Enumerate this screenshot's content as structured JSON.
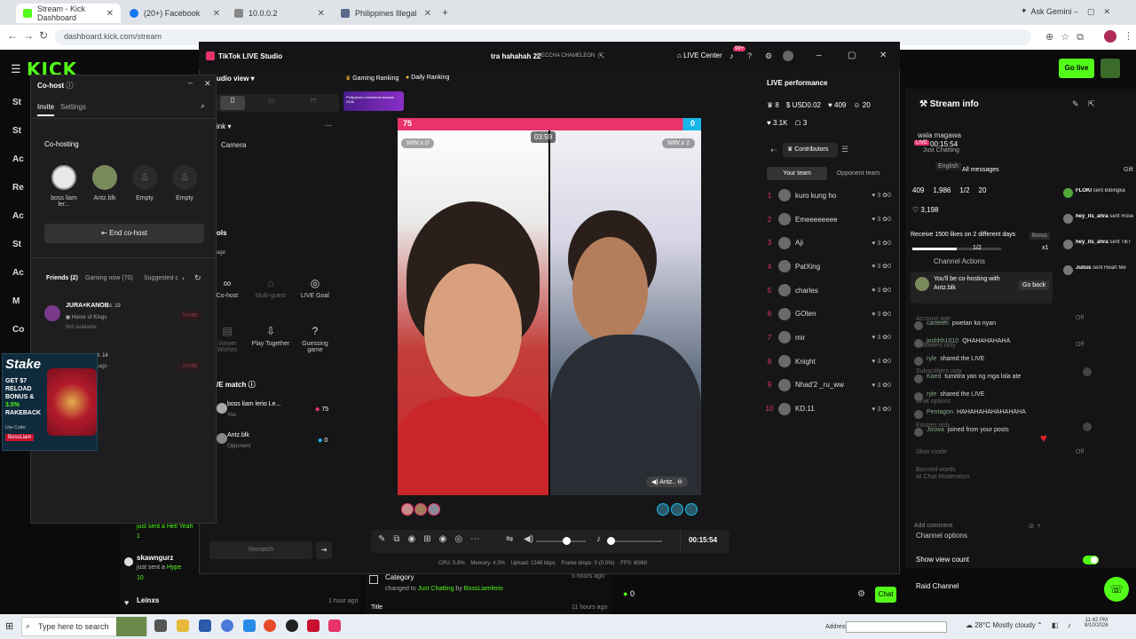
{
  "browser": {
    "tabs": [
      {
        "label": "Stream - Kick Dashboard",
        "active": true,
        "color": "#53fc18"
      },
      {
        "label": "(20+) Facebook",
        "active": false,
        "color": "#1877f2"
      },
      {
        "label": "10.0.0.2",
        "active": false,
        "color": "#888888"
      },
      {
        "label": "Philippines Illegal Site Promotio",
        "active": false,
        "color": "#5a6b8c"
      }
    ],
    "new_tab": "+",
    "url": "dashboard.kick.com/stream",
    "ask_gemini": "Ask Gemini"
  },
  "kick": {
    "logo": "KICK",
    "nav": [
      "St",
      "St",
      "Ac",
      "Re",
      "Ac",
      "St",
      "Ac",
      "M",
      "Co"
    ],
    "go_live": "Go live",
    "events": [
      {
        "user": "skawngurz",
        "action": "just sent a",
        "item": "Hype",
        "amount": "10"
      },
      {
        "user": "Leinxs",
        "time": "1 hour ago"
      }
    ],
    "partial_event": {
      "action": "just sent a",
      "item": "Hell Yeah",
      "amount": "1"
    },
    "category": {
      "title": "Category",
      "changed": "changed to",
      "to": "Just Chatting",
      "by": "by",
      "user": "BossLiamlerio",
      "time": "5 hours ago"
    },
    "title_row": {
      "title": "Title",
      "time": "11 hours ago"
    },
    "chat_count": "0",
    "chat_btn": "Chat"
  },
  "cohost": {
    "title": "Co-host",
    "tabs": [
      "Invite",
      "Settings"
    ],
    "section": "Co-hosting",
    "slots": [
      {
        "name": "boss liam ler..."
      },
      {
        "name": "Antz.blk"
      },
      {
        "name": "Empty"
      },
      {
        "name": "Empty"
      }
    ],
    "end_btn": "End co-host",
    "filters": [
      "Friends (2)",
      "Gaming now (70)",
      "Suggested c"
    ],
    "friends": [
      {
        "name": "JURA×KANOB",
        "level": "19",
        "game": "Honor of Kings",
        "status": "Not available",
        "btn": "Invite"
      },
      {
        "name": "",
        "level": "14",
        "game": "...ags",
        "status": "",
        "btn": "Invite"
      }
    ]
  },
  "ad": {
    "brand": "Stake",
    "lines": [
      "GET $7",
      "RELOAD",
      "BONUS &",
      "3.5%",
      "RAKEBACK"
    ],
    "code_label": "Use Code:",
    "code": "BossLiam"
  },
  "tiktok": {
    "app_title": "TikTok LIVE Studio",
    "stream_title": "tra hahahah 22",
    "stream_sub": "MECCHA CHAMELEON",
    "live_center": "LIVE Center",
    "badge": "99+",
    "audio_view": "udio view",
    "source_head": "ink",
    "source": "Camera",
    "tools_head": "ols",
    "tools_sub": "age",
    "tools": [
      {
        "icon": "∞",
        "label": "Co-host"
      },
      {
        "icon": "⌂",
        "label": "Multi-guest"
      },
      {
        "icon": "◎",
        "label": "LIVE Goal"
      },
      {
        "icon": "▤",
        "label": "Viewer Wishes"
      },
      {
        "icon": "⇩",
        "label": "Play Together"
      },
      {
        "icon": "?",
        "label": "Guessing game"
      }
    ],
    "match_head": "/E match",
    "match": [
      {
        "name": "boss liam lerio Le...",
        "sub": "You",
        "score": "75"
      },
      {
        "name": "Antz.blk",
        "sub": "Opponent",
        "score": "0"
      }
    ],
    "rematch": "Rematch",
    "rankings": [
      "Gaming Ranking",
      "Daily Ranking"
    ],
    "promo": "Philippines Livestream Awards 2026",
    "score_left": "75",
    "score_right": "0",
    "win_left": "WIN x 0",
    "win_right": "WIN x 1",
    "timer": "03:59",
    "opponent": "Antz..",
    "elapsed": "00:15:54",
    "stats": "CPU: 5.8%    Memory: 4.3%    Upload: 1348 kbps    Frame drops: 0 (0.0%)    FPS: 60/60"
  },
  "performance": {
    "title": "LIVE performance",
    "stats": [
      {
        "icon": "♛",
        "val": "8"
      },
      {
        "icon": "$",
        "val": "USD0.02"
      },
      {
        "icon": "♥",
        "val": "409"
      },
      {
        "icon": "☺",
        "val": "20"
      },
      {
        "icon": "♥",
        "val": "3.1K"
      },
      {
        "icon": "☖",
        "val": "3"
      }
    ],
    "contributors": "Contributors",
    "tabs": [
      "Your team",
      "Opponent team"
    ],
    "ranks": [
      {
        "n": "1",
        "name": "kuro kung ho",
        "a": "3",
        "b": "0"
      },
      {
        "n": "2",
        "name": "Emeeeeeeee",
        "a": "3",
        "b": "0"
      },
      {
        "n": "3",
        "name": "Aji",
        "a": "3",
        "b": "0"
      },
      {
        "n": "4",
        "name": "PatXing",
        "a": "3",
        "b": "0"
      },
      {
        "n": "5",
        "name": "charles",
        "a": "3",
        "b": "0"
      },
      {
        "n": "6",
        "name": "GOten",
        "a": "3",
        "b": "0"
      },
      {
        "n": "7",
        "name": "mir",
        "a": "3",
        "b": "0"
      },
      {
        "n": "8",
        "name": "Knight",
        "a": "3",
        "b": "0"
      },
      {
        "n": "9",
        "name": "Nhad'2 _ru_ww",
        "a": "3",
        "b": "0"
      },
      {
        "n": "10",
        "name": "KD.11",
        "a": "3",
        "b": "0"
      }
    ]
  },
  "streaminfo": {
    "title": "Stream info",
    "subtitle": "wala magawa",
    "time": "00:15:54",
    "category": "Just Chatting",
    "lang": "English",
    "all_messages": "All messages",
    "stats": [
      "409",
      "1,986",
      "1/2",
      "20"
    ],
    "likes": "3,198",
    "challenge": "Receive 1500 likes on 2 different days",
    "bonus": "Bonus",
    "fraction": "1/2",
    "mult": "x1",
    "channel_actions": "Channel Actions",
    "cohost_msg": "You'll be co-hosting with Antz.blk",
    "go_back": "Go back",
    "chat": [
      {
        "user": "canteen",
        "msg": "pwetan ka nyan"
      },
      {
        "user": "joshhh1010",
        "msg": "QHAHAHAHAHA"
      },
      {
        "user": "ryle",
        "msg": "shared the LIVE"
      },
      {
        "user": "Kaed",
        "msg": "tumitira yan ng mga lola ate"
      },
      {
        "user": "ryle",
        "msg": "shared the LIVE"
      },
      {
        "user": "Pentagon",
        "msg": "HAHAHAHAHAHAHAHA"
      },
      {
        "user": "Joswa",
        "msg": "joined from your posts"
      }
    ],
    "side_labels": [
      "Account age",
      "Followers only",
      "Subscribers only",
      "Chat options",
      "Emotes only",
      "Slow mode",
      "Banned words",
      "AI Chat Moderation"
    ],
    "offs": [
      "Off",
      "Off",
      "Off"
    ],
    "add_comment": "Add comment",
    "channel_options": "Channel options",
    "show_view_count": "Show view count",
    "raid_channel": "Raid Channel",
    "gifts": [
      {
        "user": "FLOKI",
        "msg": "sent Bibingka"
      },
      {
        "user": "hey_its_ahra",
        "msg": "sent Rose"
      },
      {
        "user": "hey_its_ahra",
        "msg": "sent TikT"
      },
      {
        "user": "Julius",
        "msg": "sent Heart Me"
      }
    ],
    "gift_head": "Gift"
  },
  "taskbar": {
    "search": "Type here to search",
    "address": "Address",
    "weather": "28°C  Mostly cloudy",
    "time": "11:42 PM",
    "date": "8/10/2026"
  }
}
